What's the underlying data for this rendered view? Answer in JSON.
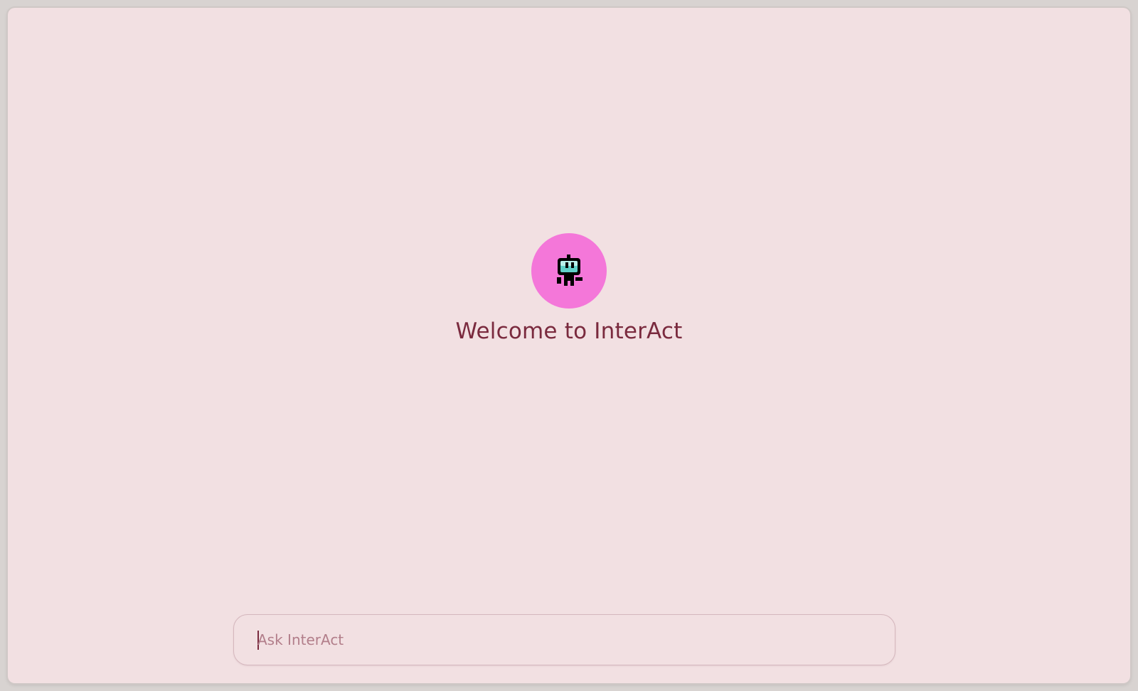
{
  "app": {
    "welcome_title": "Welcome to InterAct",
    "avatar_icon": "robot-icon",
    "avatar_color": "#f477d9",
    "accent_color": "#7a2a3e",
    "background_color": "#f2e0e2"
  },
  "chat_input": {
    "placeholder": "Ask InterAct",
    "value": ""
  }
}
